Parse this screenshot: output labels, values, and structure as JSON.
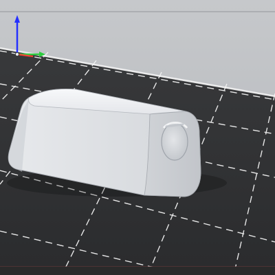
{
  "app": {
    "view": "3D viewport"
  },
  "scene": {
    "background_color": "#b9bcc0",
    "floor_color": "#3a3b3d",
    "grid_color": "#f2f2f2",
    "model_color": "#d7d9dc",
    "axis_colors": {
      "x": "#ff3b30",
      "y": "#2ecc40",
      "z": "#2430ff"
    }
  },
  "icons": {
    "axis_gizmo": "axes-gizmo-icon"
  }
}
